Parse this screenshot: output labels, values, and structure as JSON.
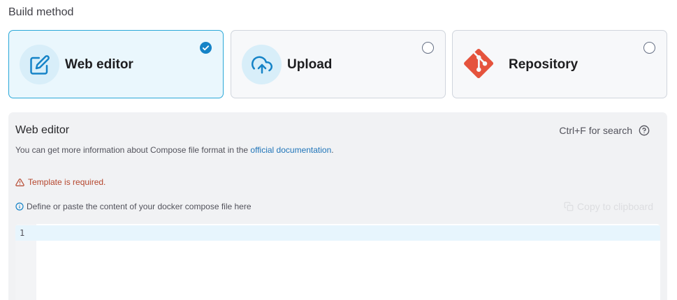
{
  "build_method": {
    "title": "Build method",
    "options": [
      {
        "label": "Web editor",
        "icon": "edit-icon",
        "selected": true
      },
      {
        "label": "Upload",
        "icon": "cloud-upload-icon",
        "selected": false
      },
      {
        "label": "Repository",
        "icon": "git-icon",
        "selected": false
      }
    ]
  },
  "editor": {
    "title": "Web editor",
    "search_hint": "Ctrl+F for search",
    "info_prefix": "You can get more information about Compose file format in the ",
    "info_link": "official documentation",
    "info_suffix": ".",
    "error": "Template is required.",
    "define_text": "Define or paste the content of your docker compose file here",
    "copy_label": "Copy to clipboard",
    "line_numbers": [
      "1"
    ],
    "content": ""
  },
  "colors": {
    "accent": "#1583c7",
    "selected_border": "#2aa8d8",
    "error": "#b5462d",
    "git": "#e5533d"
  }
}
